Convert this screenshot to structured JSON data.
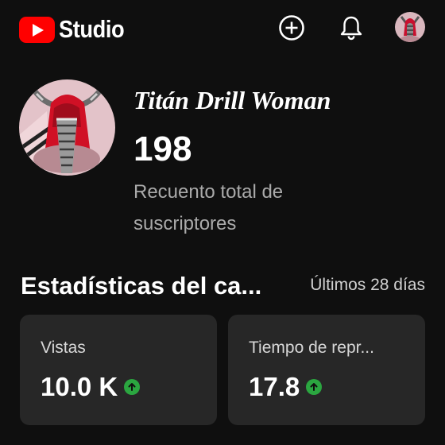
{
  "header": {
    "logo_text": "Studio",
    "create_icon": "add-circle-icon",
    "notifications_icon": "bell-icon"
  },
  "channel": {
    "name": "Titán Drill Woman",
    "subscriber_count": "198",
    "subscriber_label": "Recuento total de suscriptores"
  },
  "analytics": {
    "title": "Estadísticas del ca...",
    "period": "Últimos 28 días",
    "cards": [
      {
        "label": "Vistas",
        "value": "10.0 K",
        "trend": "up"
      },
      {
        "label": "Tiempo de repr...",
        "value": "17.8",
        "trend": "up"
      }
    ]
  },
  "colors": {
    "background": "#0f0f0f",
    "card": "#272727",
    "brand_red": "#ff0000",
    "trend_up": "#2ba640",
    "secondary_text": "#aaaaaa"
  }
}
